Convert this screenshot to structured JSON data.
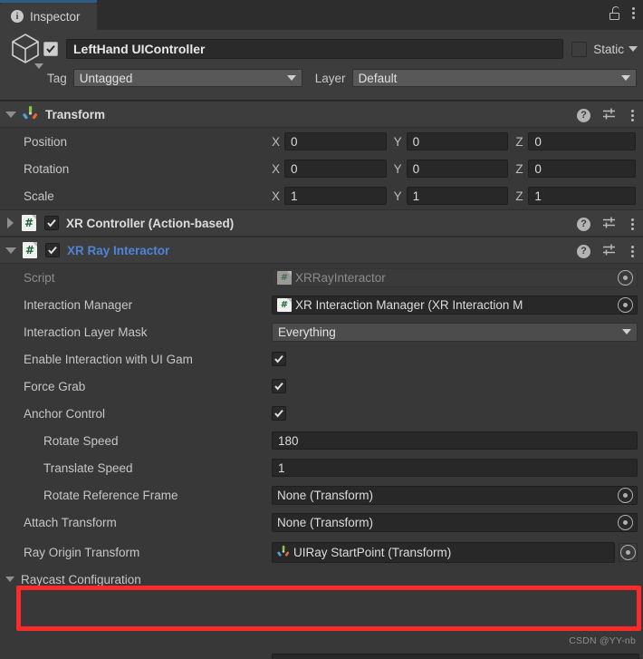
{
  "window": {
    "tab_label": "Inspector",
    "tab_icon": "info-icon",
    "lock_icon": "lock-icon",
    "menu_icon": "kebab-menu-icon"
  },
  "gameobject": {
    "icon": "cube-icon",
    "enabled": true,
    "name": "LeftHand UIController",
    "static_label": "Static",
    "static_checked": false,
    "tag_label": "Tag",
    "tag_value": "Untagged",
    "layer_label": "Layer",
    "layer_value": "Default"
  },
  "components": [
    {
      "name": "Transform",
      "icon": "transform-gizmo-icon",
      "expanded": true,
      "header_icons": [
        "help-icon",
        "preset-icon",
        "kebab-menu-icon"
      ],
      "rows": [
        {
          "label": "Position",
          "axes": [
            "X",
            "Y",
            "Z"
          ],
          "values": [
            "0",
            "0",
            "0"
          ]
        },
        {
          "label": "Rotation",
          "axes": [
            "X",
            "Y",
            "Z"
          ],
          "values": [
            "0",
            "0",
            "0"
          ]
        },
        {
          "label": "Scale",
          "axes": [
            "X",
            "Y",
            "Z"
          ],
          "values": [
            "1",
            "1",
            "1"
          ]
        }
      ]
    },
    {
      "name": "XR Controller (Action-based)",
      "icon": "csharp-script-icon",
      "expanded": false,
      "enabled": true
    },
    {
      "name": "XR Ray Interactor",
      "icon": "csharp-script-icon",
      "expanded": true,
      "enabled": true,
      "highlighted": true
    }
  ],
  "ray_interactor_fields": {
    "script": {
      "label": "Script",
      "value": "XRRayInteractor",
      "disabled": true
    },
    "interaction_manager": {
      "label": "Interaction Manager",
      "value": "XR Interaction Manager (XR Interaction M"
    },
    "interaction_layer_mask": {
      "label": "Interaction Layer Mask",
      "value": "Everything"
    },
    "enable_ui_interaction": {
      "label": "Enable Interaction with UI Gam",
      "checked": true
    },
    "force_grab": {
      "label": "Force Grab",
      "checked": true
    },
    "anchor_control": {
      "label": "Anchor Control",
      "checked": true
    },
    "rotate_speed": {
      "label": "Rotate Speed",
      "value": "180"
    },
    "translate_speed": {
      "label": "Translate Speed",
      "value": "1"
    },
    "rotate_reference_frame": {
      "label": "Rotate Reference Frame",
      "value": "None (Transform)"
    },
    "attach_transform": {
      "label": "Attach Transform",
      "value": "None (Transform)"
    },
    "ray_origin_transform": {
      "label": "Ray Origin Transform",
      "value": "UIRay StartPoint (Transform)"
    },
    "raycast_configuration": {
      "label": "Raycast Configuration"
    }
  },
  "annotation": {
    "highlight_color": "#fb2b2b",
    "highlighted_row": "Ray Origin Transform"
  },
  "watermark": "CSDN @YY-nb",
  "colors": {
    "window_bg": "#383838",
    "header_bg": "#3d3d3d",
    "tabbar_bg": "#2d2d2d",
    "field_bg": "#282828",
    "dropdown_bg": "#585858",
    "accent_blue": "#4e84d6",
    "tab_accent": "#2c5d87",
    "script_green": "#17682f"
  }
}
